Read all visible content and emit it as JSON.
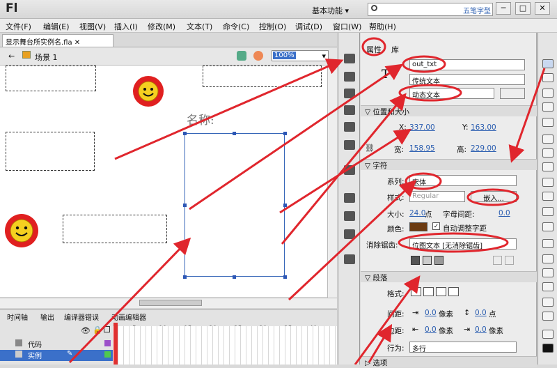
{
  "app": {
    "logo": "Fl",
    "workspace": "基本功能",
    "search_brand": "五笔字型"
  },
  "window_controls": {
    "minimize": "─",
    "maximize": "□",
    "close": "✕"
  },
  "menu": [
    "文件(F)",
    "编辑(E)",
    "视图(V)",
    "插入(I)",
    "修改(M)",
    "文本(T)",
    "命令(C)",
    "控制(O)",
    "调试(D)",
    "窗口(W)",
    "帮助(H)"
  ],
  "document": {
    "tab": "显示舞台所实例名.fla",
    "close": "✕",
    "scene": "场景 1",
    "zoom": "100%"
  },
  "stage": {
    "label_text": "名称:"
  },
  "timeline": {
    "tabs": [
      "时间轴",
      "输出",
      "编译器错误",
      "动画编辑器"
    ],
    "frame_numbers": [
      "1",
      "5",
      "10",
      "15",
      "20",
      "25",
      "30",
      "35",
      "40"
    ],
    "layers": [
      {
        "name": "代码"
      },
      {
        "name": "实例"
      }
    ]
  },
  "properties": {
    "tabs": [
      "属性",
      "库"
    ],
    "instance_name": "out_txt",
    "text_engine": "传统文本",
    "text_type": "动态文本",
    "pos_size": {
      "header": "位置和大小",
      "x_label": "X:",
      "x": "337.00",
      "y_label": "Y:",
      "y": "163.00",
      "w_label": "宽:",
      "w": "158.95",
      "h_label": "高:",
      "h": "229.00"
    },
    "character": {
      "header": "字符",
      "family_label": "系列:",
      "family": "宋体",
      "style_label": "样式:",
      "style": "Regular",
      "embed": "嵌入...",
      "size_label": "大小:",
      "size": "24.0",
      "size_unit": "点",
      "spacing_label": "字母间距:",
      "spacing": "0.0",
      "color_label": "颜色:",
      "color": "#6b3a10",
      "autokern": "自动调整字距",
      "aa_label": "消除锯齿:",
      "aa": "位图文本 [无消除锯齿]"
    },
    "paragraph": {
      "header": "段落",
      "format_label": "格式:",
      "spacing_label": "间距:",
      "indent": "0.0",
      "indent_unit": "像素",
      "line": "0.0",
      "line_unit": "点",
      "margin_label": "边距:",
      "margin_left": "0.0",
      "margin_right": "0.0",
      "margin_unit": "像素",
      "behavior_label": "行为:",
      "behavior": "多行"
    },
    "options_header": "选项"
  },
  "colors": {
    "annotation": "#e0262d",
    "accent": "#3b70c9",
    "selection": "#2d57b5"
  }
}
